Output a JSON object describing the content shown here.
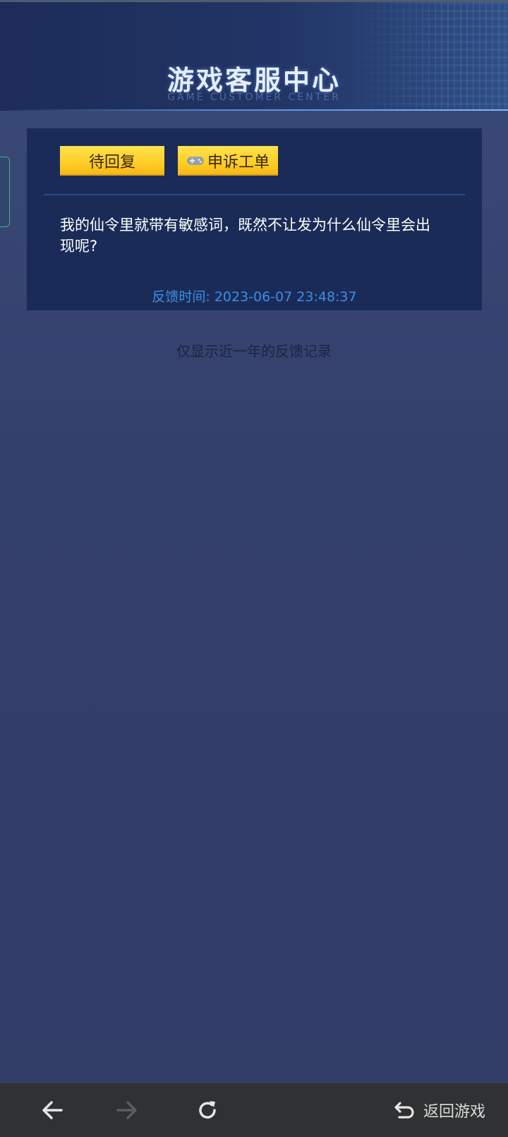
{
  "header": {
    "title": "游戏客服中心",
    "subtitle": "GAME CUSTOMER CENTER"
  },
  "ticket": {
    "status_label": "待回复",
    "appeal_label": "申诉工单",
    "appeal_icon": "gamepad-icon",
    "question": "我的仙令里就带有敏感词，既然不让发为什么仙令里会出现呢?",
    "feedback_time": "反馈时间: 2023-06-07 23:48:37"
  },
  "notice": "仅显示近一年的反馈记录",
  "navbar": {
    "back_icon": "arrow-left-icon",
    "forward_icon": "arrow-right-icon",
    "reload_icon": "reload-icon",
    "return_icon": "undo-icon",
    "return_label": "返回游戏"
  },
  "colors": {
    "badge_yellow": "#ffd02a",
    "card_bg": "#1b2b57",
    "time_blue": "#3b8ee6",
    "navbar_bg": "#2f3132"
  }
}
